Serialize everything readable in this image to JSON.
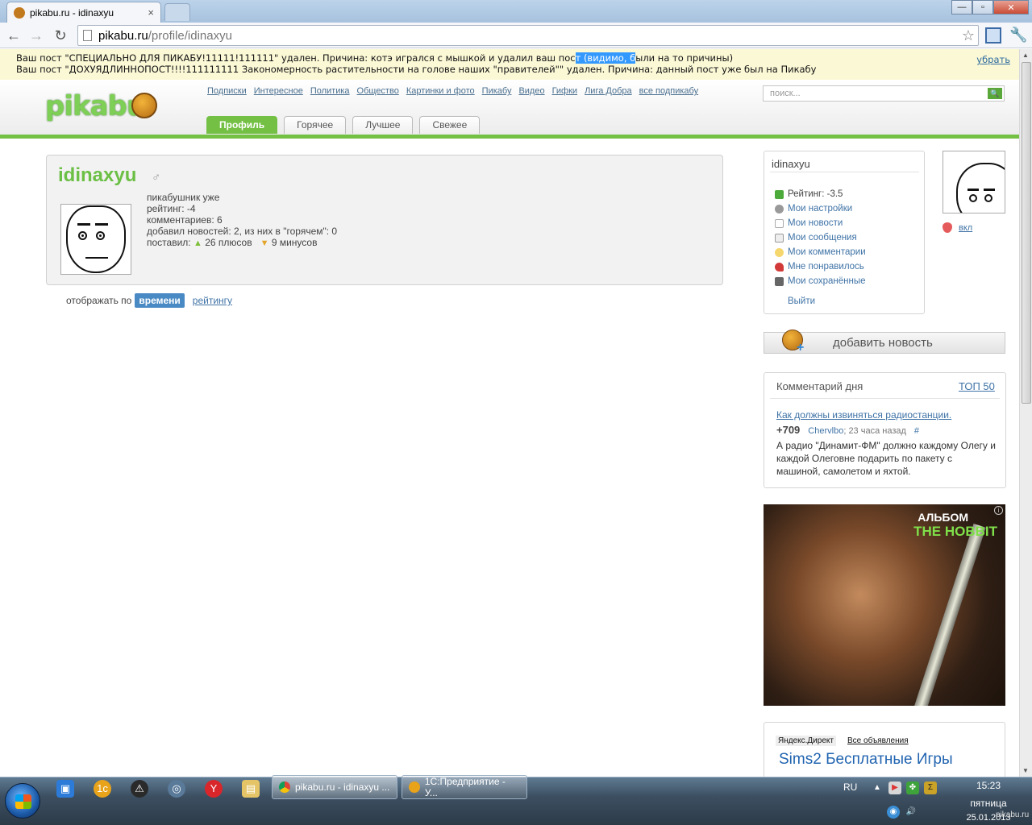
{
  "browser": {
    "tab_title": "pikabu.ru - idinaxyu",
    "tab_close": "×",
    "url_host": "pikabu.ru",
    "url_path": "/profile/idinaxyu",
    "back": "←",
    "forward": "→",
    "reload": "↻",
    "star": "☆",
    "wrench": "🔧",
    "win_min": "—",
    "win_max": "▫",
    "win_close": "✕"
  },
  "notice": {
    "line1_pre": "Ваш пост \"СПЕЦИАЛЬНО ДЛЯ ПИКАБУ!11111!111111\" удален. Причина: котэ игрался с мышкой и удалил ваш пос",
    "line1_hl": "т (видимо, б",
    "line1_post": "ыли на то причины)",
    "line2": "Ваш пост \"ДОХУЯДЛИННОПОСТ!!!!111111111 Закономерность растительности на голове наших \"правителей\"\" удален. Причина: данный пост уже был на Пикабу",
    "dismiss": "убрать"
  },
  "header": {
    "logo_text": "pikabu",
    "nav": [
      "Подписки",
      "Интересное",
      "Политика",
      "Общество",
      "Картинки и фото",
      "Пикабу",
      "Видео",
      "Гифки",
      "Лига Добра",
      "все подпикабу"
    ],
    "search_placeholder": "поиск...",
    "tabs": [
      "Профиль",
      "Горячее",
      "Лучшее",
      "Свежее"
    ],
    "active_tab": "Профиль"
  },
  "profile": {
    "username": "idinaxyu",
    "gender_icon": "♂",
    "since": "пикабушник уже",
    "rating": "рейтинг: -4",
    "comments": "комментариев: 6",
    "added_news": "добавил новостей: 2, из них в \"горячем\": 0",
    "voted_label": "поставил:",
    "pluses": "26 плюсов",
    "minuses": "9 минусов",
    "sort_label": "отображать по",
    "sort_active": "времени",
    "sort_other": "рейтингу"
  },
  "usermenu": {
    "name": "idinaxyu",
    "rating": "Рейтинг: -3.5",
    "items": [
      "Мои настройки",
      "Мои новости",
      "Мои сообщения",
      "Мои комментарии",
      "Мне понравилось",
      "Мои сохранённые"
    ],
    "exit": "Выйти",
    "toggle": "вкл"
  },
  "add_news": "добавить новость",
  "comment_day": {
    "title": "Комментарий дня",
    "top": "ТОП 50",
    "link": "Как должны извиняться радиостанции.",
    "score": "+709",
    "author": "Chervlbo",
    "time": "; 23 часа назад",
    "hash": "#",
    "text": "А радио \"Динамит-ФМ\" должно каждому Олегу и каждой Олеговне подарить по пакету с машиной, самолетом и яхтой."
  },
  "ad": {
    "line1": "АЛЬБОМ",
    "line2": "THE HOBBIT",
    "info": "i"
  },
  "direct": {
    "label": "Яндекс.Директ",
    "all": "Все объявления",
    "ad_title": "Sims2 Бесплатные Игры"
  },
  "taskbar": {
    "tasks": [
      "pikabu.ru - idinaxyu ...",
      "1С:Предприятие - У..."
    ],
    "lang": "RU",
    "time": "15:23",
    "day": "пятница",
    "date": "25.01.2013"
  },
  "watermark": "pikabu.ru",
  "colors": {
    "brand_green": "#74c044",
    "link_blue": "#3f73a6",
    "notice_bg": "#fbf8d6"
  }
}
